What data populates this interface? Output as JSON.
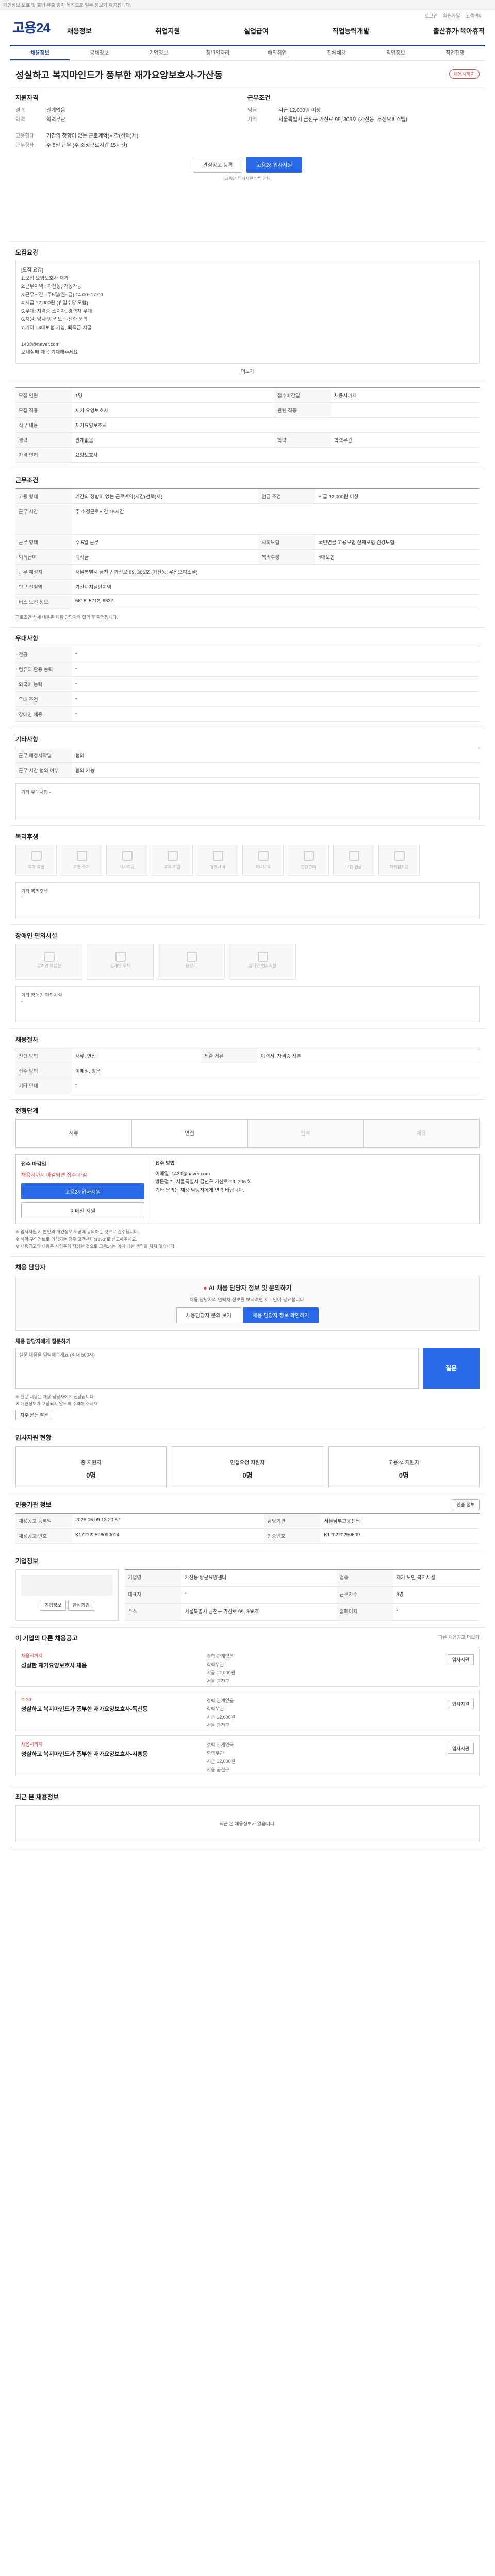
{
  "topbar": {
    "note": "개인정보 보호 및 불법 유출 방지 목적으로 일부 정보가 제공됩니다.",
    "links": [
      "로그인",
      "회원가입",
      "고객센터"
    ]
  },
  "header": {
    "logo": "고용24",
    "nav": [
      "채용정보",
      "취업지원",
      "실업급여",
      "직업능력개발",
      "출산휴가·육아휴직"
    ]
  },
  "subtabs": [
    "채용정보",
    "공채정보",
    "기업정보",
    "청년일자리",
    "해외취업",
    "전체채용",
    "직업정보",
    "직업전망"
  ],
  "job": {
    "title": "성실하고 복지마인드가 풍부한 재가요양보호사-가산동",
    "badge": "채용시까지",
    "recruit_label": "지원자격",
    "recruit": [
      {
        "k": "경력",
        "v": "관계없음"
      },
      {
        "k": "학력",
        "v": "학력무관"
      }
    ],
    "work_label": "근무조건",
    "work": [
      {
        "k": "임금",
        "v": "시급 12,000원 이상"
      },
      {
        "k": "지역",
        "v": "서울특별시 금천구 가산로 99, 306호 (가산동, 우신오피스텔)"
      }
    ],
    "work2": [
      {
        "k": "고용형태",
        "v": "기간의 정함이 없는 근로계약(시간(선택)제)"
      },
      {
        "k": "근무형태",
        "v": "주 5일 근무 (주 소정근로시간 15시간)"
      }
    ],
    "extra_label": "복리후생",
    "btn_interest": "관심공고 등록",
    "btn_apply": "고용24 입사지원",
    "apply_note": "고용24 입사지원 방법 안내"
  },
  "detail": {
    "h": "모집요강",
    "lines": [
      "[모집 요강]",
      "1.모집 요양보호사 재가",
      "2.근무지역 : 가산동, 가동가능",
      "3.근무시간 : 주5일(월~금) 14:00~17:00",
      "4.시급 12,000원 (휴일수당 포함)",
      "5.우대: 자격증 소지자, 경력자 우대",
      "6.지원: 당사 방문 또는 전화 문의",
      "7.기타 : 4대보험 가입, 퇴직금 지급",
      "",
      "1433@naver.com",
      "보내실때 제목 기재해주세요"
    ],
    "more": "더보기"
  },
  "basic": {
    "rows": [
      [
        "모집 인원",
        "1명",
        "접수마감일",
        "채용시까지"
      ],
      [
        "모집 직종",
        "재가 요양보호사",
        "관련 직종",
        ""
      ],
      [
        "직무 내용",
        "재가요양보호사"
      ],
      [
        "경력",
        "관계없음",
        "학력",
        "학력무관"
      ],
      [
        "자격 면허",
        "요양보호사"
      ]
    ]
  },
  "conditions": {
    "h": "근무조건",
    "rows": [
      [
        "고용 형태",
        "기간의 정함이 없는 근로계약(시간(선택)제)",
        "임금 조건",
        "시급 12,000원 이상"
      ],
      [
        "근무 시간",
        "주 소정근로시간 15시간",
        "",
        ""
      ],
      [
        "근무 형태",
        "주 5일 근무",
        "사회보험",
        "국민연금 고용보험 산재보험 건강보험"
      ],
      [
        "퇴직급여",
        "퇴직금",
        "복리후생",
        "4대보험"
      ],
      [
        "근무 예정지",
        "서울특별시 금천구 가산로 99, 306호 (가산동, 우신오피스텔)",
        "",
        ""
      ],
      [
        "인근 전철역",
        "가산디지털단지역",
        "",
        ""
      ],
      [
        "버스 노선 정보",
        "5616, 5712, 6637",
        "",
        ""
      ]
    ],
    "note": "근로조건 상세 내용은 채용 담당자와 협의 후 확정됩니다."
  },
  "pref": {
    "h": "우대사항",
    "rows": [
      [
        "전공",
        "-"
      ],
      [
        "컴퓨터 활용 능력",
        "-"
      ],
      [
        "외국어 능력",
        "-"
      ],
      [
        "우대 조건",
        "-"
      ],
      [
        "장애인 채용",
        "-"
      ]
    ]
  },
  "etc": {
    "h": "기타사항",
    "rows": [
      [
        "근무 예정시작일",
        "협의"
      ],
      [
        "근무 시간 협의 여부",
        "협의 가능"
      ],
      [
        "기타 우대사항",
        "-"
      ]
    ]
  },
  "welfare": {
    "h": "복리후생",
    "items": [
      "휴가·휴일",
      "교통·주차",
      "식사제공",
      "교육·지원",
      "경조사비",
      "자녀보육",
      "건강관리",
      "보험·연금",
      "재취업지원"
    ],
    "etc_label": "기타 복리후생",
    "etc_value": "-"
  },
  "disability": {
    "h": "장애인 편의시설",
    "items": [
      "장애인 화장실",
      "장애인 주차",
      "승강기",
      "장애인 편의시설"
    ],
    "etc_label": "기타 장애인 편의시설",
    "etc_value": "-"
  },
  "process": {
    "h": "채용절차",
    "rows": [
      [
        "전형 방법",
        "서류, 면접",
        "제출 서류",
        "이력서, 자격증 사본"
      ],
      [
        "접수 방법",
        "이메일, 방문",
        "",
        ""
      ],
      [
        "기타 안내",
        "-",
        "",
        ""
      ]
    ]
  },
  "steps": {
    "h": "전형단계",
    "items": [
      "서류",
      "면접",
      "합격",
      "채용"
    ]
  },
  "apply": {
    "h": "접수 마감일",
    "deadline": "채용시까지 마감되면 접수 마감",
    "btn1": "고용24 입사지원",
    "btn2": "이메일 지원",
    "right_h": "접수 방법",
    "right": [
      "이메일: 1433@naver.com",
      "방문접수: 서울특별시 금천구 가산로 99, 306호",
      "기타 문의는 채용 담당자에게 연락 바랍니다."
    ],
    "notes": [
      "※ 입사지원 시 본인의 개인정보 제공에 동의하는 것으로 간주됩니다.",
      "※ 허위 구인정보로 의심되는 경우 고객센터(1350)로 신고해주세요.",
      "※ 채용공고의 내용은 사업주가 작성한 것으로 고용24는 이에 대한 책임을 지지 않습니다."
    ]
  },
  "contact": {
    "h": "채용 담당자",
    "ai_title": "AI 채용 담당자 정보 및 문의하기",
    "ai_desc": "채용 담당자의 연락처 정보를 보시려면 로그인이 필요합니다.",
    "btn1": "채용담당자 문의 보기",
    "btn2": "채용 담당자 정보 확인하기",
    "q_label": "채용 담당자에게 질문하기",
    "q_placeholder": "질문 내용을 입력해주세요 (최대 500자)",
    "q_btn": "질문",
    "notes": [
      "※ 질문 내용은 채용 담당자에게 전달됩니다.",
      "※ 개인정보가 포함되지 않도록 주의해 주세요."
    ],
    "link": "자주 묻는 질문"
  },
  "status": {
    "h": "입사지원 현황",
    "items": [
      {
        "k": "총 지원자",
        "v": "0명"
      },
      {
        "k": "면접요청 지원자",
        "v": "0명"
      },
      {
        "k": "고용24 지원자",
        "v": "0명"
      }
    ]
  },
  "info": {
    "h": "인증기관 정보",
    "btn": "인증 정보",
    "rows": [
      [
        "채용공고 등록일",
        "2025.06.09 13:20:57",
        "담당기관",
        "서울남부고용센터"
      ],
      [
        "채용공고 번호",
        "K172122506090014",
        "인증번호",
        "K120220250609"
      ]
    ]
  },
  "company": {
    "h": "기업정보",
    "name": "가산동 방문요양센터",
    "rows": [
      [
        "기업명",
        "가산동 방문요양센터",
        "업종",
        "재가 노인 복지시설"
      ],
      [
        "대표자",
        "-",
        "근로자수",
        "3명"
      ],
      [
        "주소",
        "서울특별시 금천구 가산로 99, 306호",
        "홈페이지",
        "-"
      ]
    ],
    "btns": [
      "기업정보",
      "관심기업"
    ]
  },
  "others": {
    "h": "이 기업의 다른 채용공고",
    "link": "다른 채용공고 더보기",
    "items": [
      {
        "tag": "채용시까지",
        "title": "성실한 재가요양보호사 채용",
        "meta": [
          "경력 관계없음",
          "학력무관",
          "시급 12,000원",
          "서울 금천구"
        ],
        "btn": "입사지원"
      },
      {
        "tag": "D-30",
        "title": "성실하고 복지마인드가 풍부한 재가요양보호사-독산동",
        "meta": [
          "경력 관계없음",
          "학력무관",
          "시급 12,000원",
          "서울 금천구"
        ],
        "btn": "입사지원"
      },
      {
        "tag": "채용시까지",
        "title": "성실하고 복지마인드가 풍부한 재가요양보호사-시흥동",
        "meta": [
          "경력 관계없음",
          "학력무관",
          "시급 12,000원",
          "서울 금천구"
        ],
        "btn": "입사지원"
      }
    ]
  },
  "recent": {
    "h": "최근 본 채용정보",
    "empty": "최근 본 채용정보가 없습니다."
  }
}
